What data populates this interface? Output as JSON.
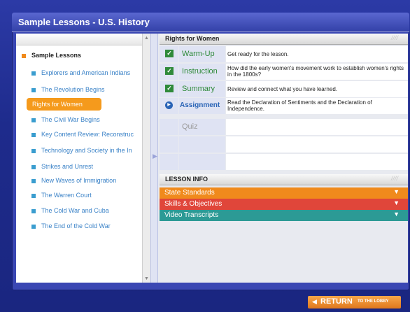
{
  "window": {
    "title": "Sample Lessons - U.S. History"
  },
  "sidebar": {
    "root": "Sample Lessons",
    "items": [
      "Explorers and American Indians",
      "The Revolution Begins",
      "Rights for Women",
      "The Civil War Begins",
      "Key Content Review: Reconstruc",
      "Technology and Society in the In",
      "Strikes and Unrest",
      "New Waves of Immigration",
      "The Warren Court",
      "The Cold War and Cuba",
      "The End of the Cold War"
    ],
    "active": "Rights for Women"
  },
  "lesson": {
    "title": "Rights for Women",
    "rows": [
      {
        "name": "Warm-Up",
        "desc": "Get ready for the lesson.",
        "icon": "check-icon",
        "color": "#2f8a3a"
      },
      {
        "name": "Instruction",
        "desc": "How did the early women's movement work to establish women's rights in the 1800s?",
        "icon": "check-icon",
        "color": "#2f8a3a"
      },
      {
        "name": "Summary",
        "desc": "Review and connect what you have learned.",
        "icon": "check-icon",
        "color": "#2f8a3a"
      },
      {
        "name": "Assignment",
        "desc": "Read the Declaration of Sentiments and the Declaration of Independence.",
        "icon": "play-icon",
        "color": "#2a64b6"
      },
      {
        "name": "Quiz",
        "desc": "",
        "icon": "",
        "color": "#9a9a9a"
      }
    ]
  },
  "lesson_info": {
    "title": "LESSON INFO",
    "bars": [
      {
        "label": "State Standards",
        "color": "#f08a1c"
      },
      {
        "label": "Skills & Objectives",
        "color": "#e0463a"
      },
      {
        "label": "Video Transcripts",
        "color": "#2c9a95"
      }
    ]
  },
  "footer": {
    "return_label": "RETURN",
    "return_sub": "TO THE LOBBY"
  },
  "hatch": "////"
}
